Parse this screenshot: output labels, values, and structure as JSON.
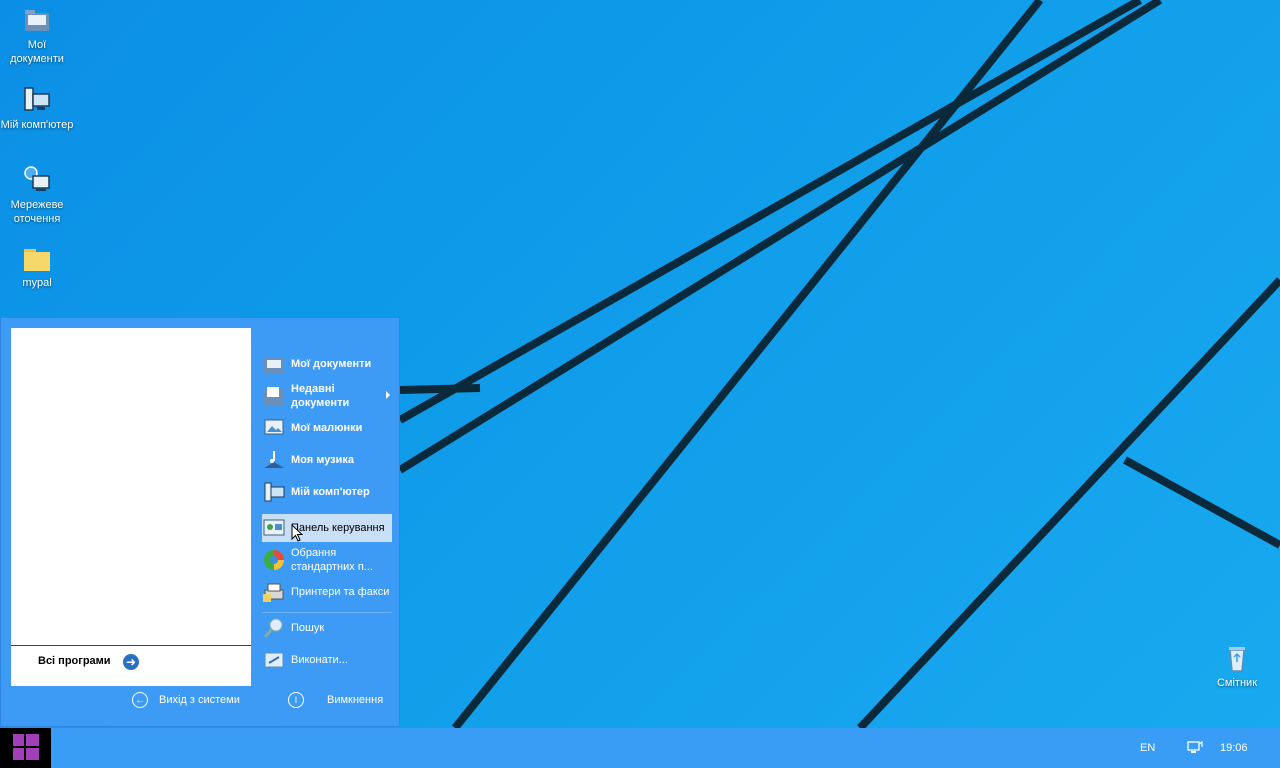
{
  "desktop": {
    "icons": [
      {
        "name": "my-documents",
        "label": "Мої документи",
        "icon": "folder-docs-icon"
      },
      {
        "name": "my-computer",
        "label": "Мій комп'ютер",
        "icon": "computer-icon"
      },
      {
        "name": "network",
        "label": "Мережеве оточення",
        "icon": "network-icon"
      },
      {
        "name": "mypal",
        "label": "mypal",
        "icon": "folder-icon"
      },
      {
        "name": "recycle-bin",
        "label": "Смітник",
        "icon": "recycle-bin-icon"
      }
    ]
  },
  "startmenu": {
    "all_programs": "Всі програми",
    "right_items": [
      {
        "label": "Мої документи",
        "icon": "folder-docs-icon"
      },
      {
        "label": "Недавні документи",
        "icon": "recent-docs-icon",
        "submenu": true
      },
      {
        "label": "Мої малюнки",
        "icon": "pictures-icon"
      },
      {
        "label": "Моя музика",
        "icon": "music-icon"
      },
      {
        "label": "Мій комп'ютер",
        "icon": "computer-icon"
      },
      {
        "label": "Панель керування",
        "icon": "control-panel-icon",
        "highlighted": true
      },
      {
        "label": "Обрання стандартних п...",
        "icon": "default-programs-icon"
      },
      {
        "label": "Принтери та факси",
        "icon": "printers-icon"
      },
      {
        "label": "Пошук",
        "icon": "search-icon"
      },
      {
        "label": "Виконати...",
        "icon": "run-icon"
      }
    ],
    "logoff": "Вихід з системи",
    "shutdown": "Вимкнення"
  },
  "taskbar": {
    "language": "EN",
    "clock": "19:06",
    "accent": "#3a9df5",
    "start_icon": "windows-logo-icon",
    "tray_icon": "network-tray-icon"
  }
}
